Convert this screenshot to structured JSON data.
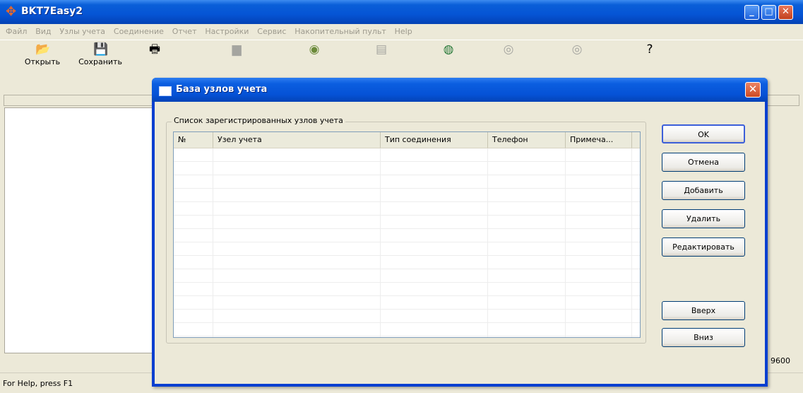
{
  "window": {
    "title": "BKT7Easy2",
    "controls": {
      "minimize": "_",
      "maximize": "□",
      "close": "✕"
    }
  },
  "menu": [
    "Файл",
    "Вид",
    "Узлы учета",
    "Соединение",
    "Отчет",
    "Настройки",
    "Сервис",
    "Накопительный пульт",
    "Help"
  ],
  "toolbar": {
    "buttons": [
      {
        "label": "Открыть",
        "icon": "folder-open-icon",
        "glyph": "📂",
        "enabled": true
      },
      {
        "label": "Сохранить",
        "icon": "floppy-disk-icon",
        "glyph": "💾",
        "enabled": true
      },
      {
        "label": "",
        "icon": "printer-icon",
        "glyph": "🖶",
        "enabled": true
      },
      {
        "label": "",
        "icon": "document-icon",
        "glyph": "▆",
        "enabled": false
      },
      {
        "label": "",
        "icon": "connect-icon",
        "glyph": "◉",
        "enabled": true
      },
      {
        "label": "",
        "icon": "report-icon",
        "glyph": "▤",
        "enabled": false
      },
      {
        "label": "",
        "icon": "globe-search-icon",
        "glyph": "◍",
        "enabled": true
      },
      {
        "label": "",
        "icon": "stop-icon",
        "glyph": "◎",
        "enabled": false
      },
      {
        "label": "",
        "icon": "stop-icon",
        "glyph": "◎",
        "enabled": false
      },
      {
        "label": "",
        "icon": "help-icon",
        "glyph": "?",
        "enabled": true
      }
    ]
  },
  "statusbar": {
    "help_text": "For Help, press F1",
    "baud": "9600"
  },
  "dialog": {
    "title": "База узлов учета",
    "group_label": "Список зарегистрированных узлов учета",
    "columns": [
      "№",
      "Узел учета",
      "Тип соединения",
      "Телефон",
      "Примеча..."
    ],
    "rows": [],
    "buttons": {
      "ok": "OK",
      "cancel": "Отмена",
      "add": "Добавить",
      "delete": "Удалить",
      "edit": "Редактировать",
      "up": "Вверх",
      "down": "Вниз"
    }
  }
}
